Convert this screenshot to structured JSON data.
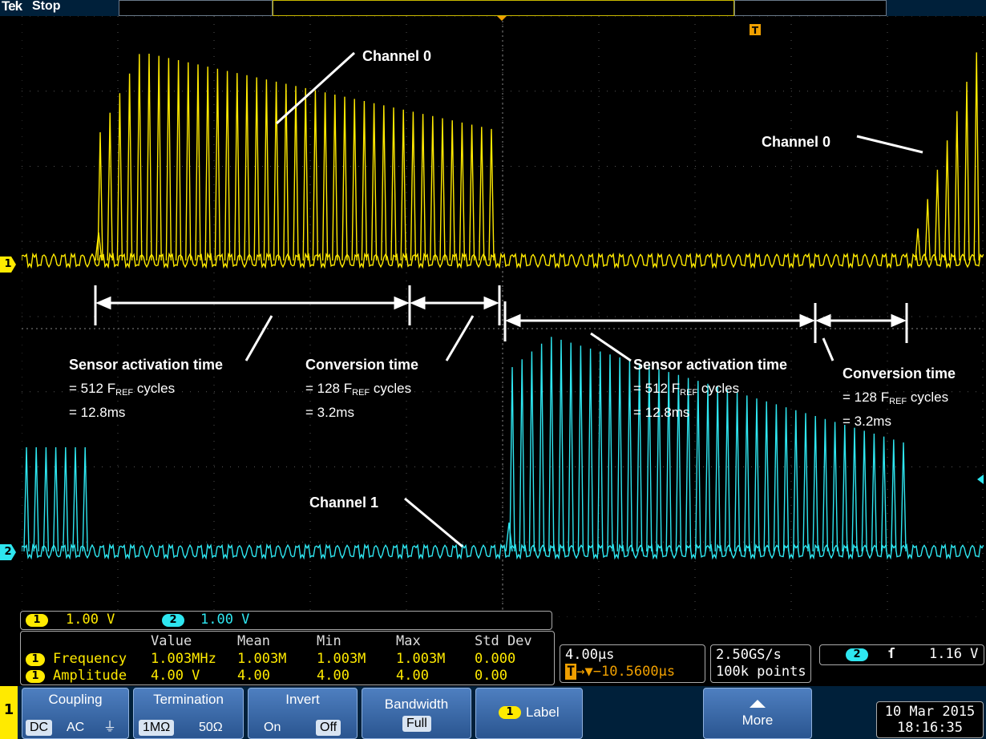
{
  "status_bar": {
    "brand": "Tek",
    "status": "Stop"
  },
  "annotations": {
    "channel0_top": "Channel 0",
    "channel0_right": "Channel 0",
    "channel1": "Channel 1",
    "sensor_activation_1": {
      "title": "Sensor activation time",
      "line1_prefix": "= 512 F",
      "line1_sub": "REF",
      "line1_suffix": " cycles",
      "line2": "= 12.8ms"
    },
    "conversion_1": {
      "title": "Conversion time",
      "line1_prefix": "= 128 F",
      "line1_sub": "REF",
      "line1_suffix": " cycles",
      "line2": "= 3.2ms"
    },
    "sensor_activation_2": {
      "title": "Sensor activation time",
      "line1_prefix": "= 512 F",
      "line1_sub": "REF",
      "line1_suffix": " cycles",
      "line2": "= 12.8ms"
    },
    "conversion_2": {
      "title": "Conversion time",
      "line1_prefix": "= 128 F",
      "line1_sub": "REF",
      "line1_suffix": " cycles",
      "line2": "= 3.2ms"
    }
  },
  "channels": {
    "ch1": {
      "marker": "1",
      "color": "#ffea00",
      "scale": "1.00 V"
    },
    "ch2": {
      "marker": "2",
      "color": "#2ee6f0",
      "scale": "1.00 V"
    }
  },
  "measurements": {
    "headers": [
      "Value",
      "Mean",
      "Min",
      "Max",
      "Std Dev"
    ],
    "rows": [
      {
        "channel": "1",
        "name": "Frequency",
        "values": [
          "1.003MHz",
          "1.003M",
          "1.003M",
          "1.003M",
          "0.000"
        ]
      },
      {
        "channel": "1",
        "name": "Amplitude",
        "values": [
          "4.00 V",
          "4.00",
          "4.00",
          "4.00",
          "0.00"
        ]
      }
    ]
  },
  "timebase": {
    "scale": "4.00µs",
    "trigger_pos": "▼−10.5600µs"
  },
  "acquisition": {
    "rate": "2.50GS/s",
    "points": "100k points"
  },
  "trigger": {
    "source": "2",
    "slope": "ſ",
    "level": "1.16 V"
  },
  "menu": {
    "side_marker": "1",
    "coupling": {
      "title": "Coupling",
      "options": [
        "DC",
        "AC",
        "⏚"
      ]
    },
    "termination": {
      "title": "Termination",
      "options": [
        "1MΩ",
        "50Ω"
      ]
    },
    "invert": {
      "title": "Invert",
      "options": [
        "On",
        "Off"
      ]
    },
    "bandwidth": {
      "title": "Bandwidth",
      "value": "Full"
    },
    "label": {
      "badge": "1",
      "title": "Label"
    },
    "more": {
      "title": "More"
    }
  },
  "datetime": {
    "date": "10 Mar 2015",
    "time": "18:16:35"
  }
}
